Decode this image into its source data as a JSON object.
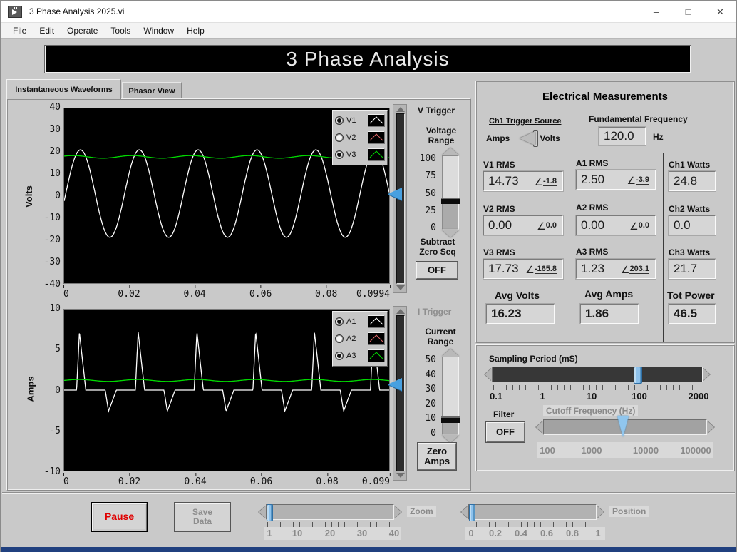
{
  "window": {
    "title": "3 Phase Analysis 2025.vi",
    "icons": {
      "minimize": "–",
      "maximize": "□",
      "close": "✕"
    }
  },
  "menu": {
    "items": [
      "File",
      "Edit",
      "Operate",
      "Tools",
      "Window",
      "Help"
    ]
  },
  "banner": {
    "title": "3 Phase Analysis"
  },
  "tabs": [
    {
      "label": "Instantaneous Waveforms"
    },
    {
      "label": "Phasor View"
    }
  ],
  "volts_group": {
    "trigger_label": "V Trigger",
    "range_label1": "Voltage",
    "range_label2": "Range",
    "range_ticks": [
      "100",
      "75",
      "50",
      "25",
      "0"
    ],
    "range_value": 40,
    "subtract_label1": "Subtract",
    "subtract_label2": "Zero Seq",
    "subtract_button": "OFF"
  },
  "amps_group": {
    "trigger_label": "I Trigger",
    "range_label1": "Current",
    "range_label2": "Range",
    "range_ticks": [
      "50",
      "40",
      "30",
      "20",
      "10",
      "0"
    ],
    "range_value": 10,
    "zero_button_line1": "Zero",
    "zero_button_line2": "Amps"
  },
  "measurements": {
    "title": "Electrical Measurements",
    "angle_symbol": "∠",
    "trigger_source": {
      "label": "Ch1 Trigger Source",
      "left": "Amps",
      "right": "Volts",
      "selected": "Volts"
    },
    "fundamental": {
      "label": "Fundamental Frequency",
      "value": "120.0",
      "unit": "Hz"
    },
    "columns": [
      {
        "items": [
          {
            "label": "V1 RMS",
            "value": "14.73",
            "angle": "-1.8"
          },
          {
            "label": "V2 RMS",
            "value": "0.00",
            "angle": "0.0"
          },
          {
            "label": "V3 RMS",
            "value": "17.73",
            "angle": "-165.8"
          }
        ],
        "summary": {
          "label": "Avg Volts",
          "value": "16.23"
        }
      },
      {
        "items": [
          {
            "label": "A1 RMS",
            "value": "2.50",
            "angle": "-3.9"
          },
          {
            "label": "A2 RMS",
            "value": "0.00",
            "angle": "0.0"
          },
          {
            "label": "A3 RMS",
            "value": "1.23",
            "angle": "203.1"
          }
        ],
        "summary": {
          "label": "Avg Amps",
          "value": "1.86"
        }
      },
      {
        "items": [
          {
            "label": "Ch1 Watts",
            "value": "24.8"
          },
          {
            "label": "Ch2 Watts",
            "value": "0.0"
          },
          {
            "label": "Ch3 Watts",
            "value": "21.7"
          }
        ],
        "summary": {
          "label": "Tot Power",
          "value": "46.5"
        }
      }
    ]
  },
  "sampling": {
    "label": "Sampling Period (mS)",
    "ticks": [
      "0.1",
      "1",
      "10",
      "100",
      "2000"
    ],
    "value": "100"
  },
  "filter": {
    "label": "Filter",
    "button": "OFF"
  },
  "cutoff": {
    "label": "Cutoff Frequency (Hz)",
    "ticks": [
      "100",
      "1000",
      "10000",
      "100000"
    ],
    "value": "3000"
  },
  "footer": {
    "pause": "Pause",
    "save_line1": "Save",
    "save_line2": "Data",
    "zoom": {
      "label": "Zoom",
      "ticks": [
        "1",
        "10",
        "20",
        "30",
        "40"
      ],
      "value": "1"
    },
    "position": {
      "label": "Position",
      "ticks": [
        "0",
        "0.2",
        "0.4",
        "0.6",
        "0.8",
        "1"
      ],
      "value": "0"
    }
  },
  "colors": {
    "accent_blue": "#58a8e4",
    "plot_bg": "#000000",
    "panel_gray": "#c9c9c9",
    "pause_red": "#e00000",
    "series_white": "#ffffff",
    "series_red": "#e06666",
    "series_green": "#00d800"
  },
  "chart_data": [
    {
      "type": "line",
      "ylabel": "Volts",
      "ylim": [
        -40,
        40
      ],
      "yticks": [
        "40",
        "30",
        "20",
        "10",
        "0",
        "-10",
        "-20",
        "-30",
        "-40"
      ],
      "xlim": [
        0,
        0.0994
      ],
      "xticks": [
        "0",
        "0.02",
        "0.04",
        "0.06",
        "0.08",
        "0.0994"
      ],
      "grid": false,
      "legend_position": "top-right",
      "legend": [
        {
          "name": "V1",
          "enabled": true,
          "color": "#ffffff"
        },
        {
          "name": "V2",
          "enabled": false,
          "color": "#e06666"
        },
        {
          "name": "V3",
          "enabled": true,
          "color": "#00d800"
        }
      ],
      "series": [
        {
          "name": "V1",
          "color": "#ffffff",
          "gen": {
            "kind": "sine",
            "offset": 1,
            "amplitude": 20,
            "period": 0.018,
            "phase": -0.17
          }
        },
        {
          "name": "V3",
          "color": "#00d800",
          "gen": {
            "kind": "sine",
            "offset": 17.8,
            "amplitude": 0.6,
            "period": 0.018,
            "phase": 0.6
          }
        }
      ],
      "trigger_level_fraction": 0.47
    },
    {
      "type": "line",
      "ylabel": "Amps",
      "ylim": [
        -10,
        10
      ],
      "yticks": [
        "10",
        "5",
        "0",
        "-5",
        "-10"
      ],
      "xlim": [
        0,
        0.099
      ],
      "xticks": [
        "0",
        "0.02",
        "0.04",
        "0.06",
        "0.08",
        "0.099"
      ],
      "grid": false,
      "legend_position": "top-right",
      "legend": [
        {
          "name": "A1",
          "enabled": true,
          "color": "#ffffff"
        },
        {
          "name": "A2",
          "enabled": false,
          "color": "#e06666"
        },
        {
          "name": "A3",
          "enabled": true,
          "color": "#00d800"
        }
      ],
      "series": [
        {
          "name": "A1",
          "color": "#ffffff",
          "gen": {
            "kind": "pulse",
            "baseline": 0,
            "period": 0.0179,
            "pulses": [
              {
                "start": 0.0038,
                "height": 7.2,
                "width": 0.0028
              },
              {
                "start": 0.0125,
                "height": -2.6,
                "width": 0.0034
              }
            ]
          }
        },
        {
          "name": "A3",
          "color": "#00d800",
          "gen": {
            "kind": "sine",
            "offset": 1.2,
            "amplitude": 0.12,
            "period": 0.0179,
            "phase": 0
          }
        }
      ],
      "trigger_level_fraction": 0.45
    }
  ]
}
